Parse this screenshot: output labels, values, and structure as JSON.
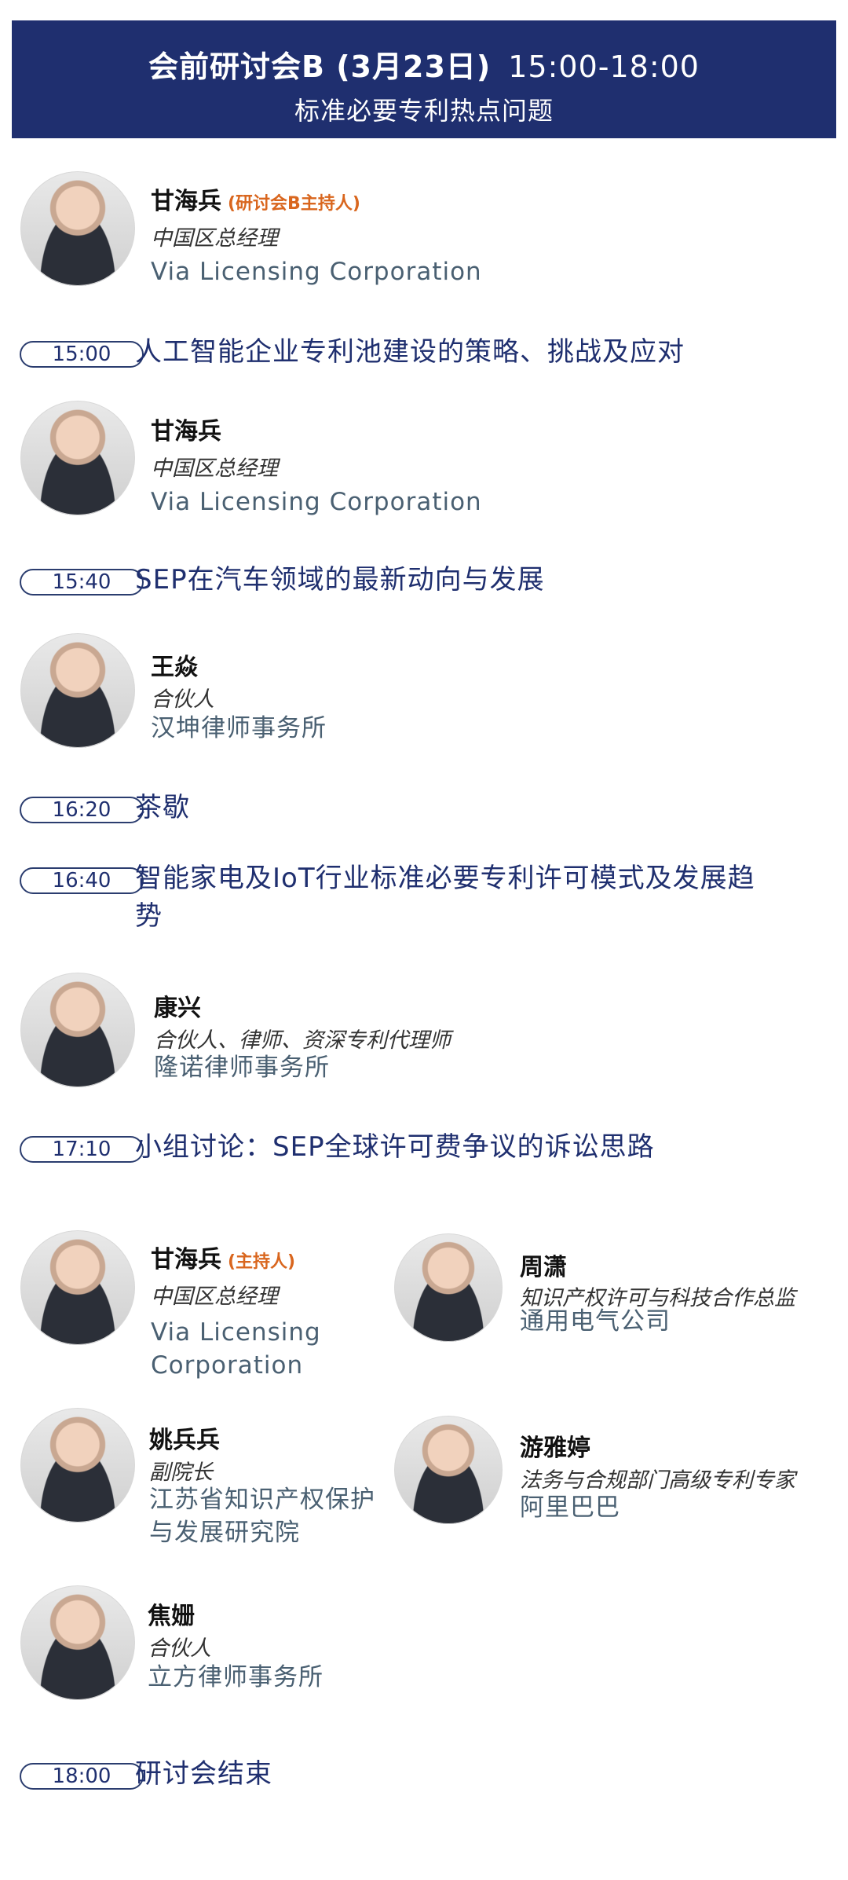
{
  "header": {
    "title": "会前研讨会B (3月23日)",
    "time": "15:00-18:00",
    "subtitle": "标准必要专利热点问题"
  },
  "host": {
    "name": "甘海兵",
    "tag": "(研讨会B主持人)",
    "role": "中国区总经理",
    "org": "Via Licensing Corporation"
  },
  "sessions": [
    {
      "time": "15:00",
      "title": "人工智能企业专利池建设的策略、挑战及应对",
      "speaker": {
        "name": "甘海兵",
        "role": "中国区总经理",
        "org": "Via Licensing Corporation"
      }
    },
    {
      "time": "15:40",
      "title": "SEP在汽车领域的最新动向与发展",
      "speaker": {
        "name": "王焱",
        "role": "合伙人",
        "org": "汉坤律师事务所"
      }
    },
    {
      "time": "16:20",
      "title": "茶歇"
    },
    {
      "time": "16:40",
      "title": "智能家电及IoT行业标准必要专利许可模式及发展趋势",
      "speaker": {
        "name": "康兴",
        "role": "合伙人、律师、资深专利代理师",
        "org": "隆诺律师事务所"
      }
    },
    {
      "time": "17:10",
      "title": "小组讨论：SEP全球许可费争议的诉讼思路"
    },
    {
      "time": "18:00",
      "title": "研讨会结束"
    }
  ],
  "panel": [
    {
      "name": "甘海兵",
      "tag": "(主持人)",
      "role": "中国区总经理",
      "org": "Via Licensing Corporation"
    },
    {
      "name": "周潇",
      "role": "知识产权许可与科技合作总监",
      "org": "通用电气公司"
    },
    {
      "name": "姚兵兵",
      "role": "副院长",
      "org": "江苏省知识产权保护与发展研究院"
    },
    {
      "name": "游雅婷",
      "role": "法务与合规部门高级专利专家",
      "org": "阿里巴巴"
    },
    {
      "name": "焦姗",
      "role": "合伙人",
      "org": "立方律师事务所"
    }
  ],
  "colors": {
    "header_bg": "#1f2f6f",
    "accent": "#1f2f6f",
    "host_tag": "#d9661e",
    "org_text": "#4a6072"
  }
}
